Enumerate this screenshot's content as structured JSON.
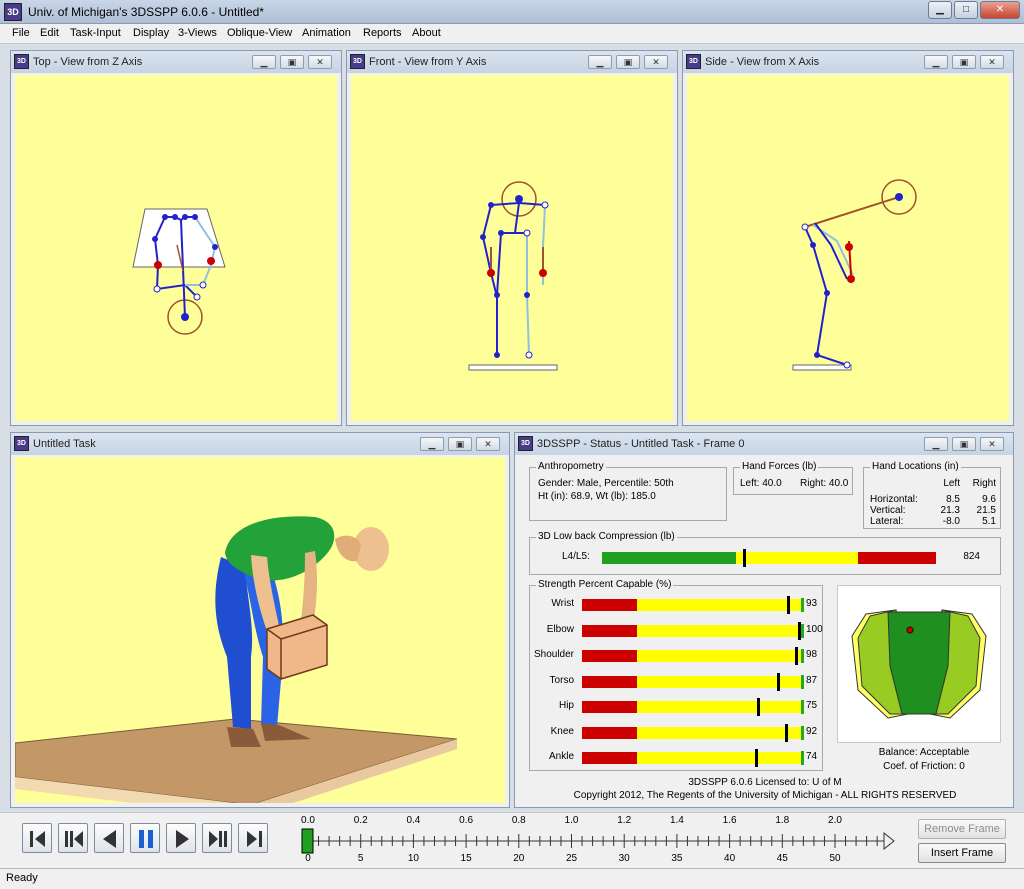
{
  "window": {
    "title": "Univ. of Michigan's 3DSSPP 6.0.6 - Untitled*",
    "icon": "3DSSPP-app-icon",
    "icon_text": "3D",
    "controls": [
      "minimize",
      "maximize",
      "close"
    ]
  },
  "menu": [
    "File",
    "Edit",
    "Task-Input",
    "Display",
    "3-Views",
    "Oblique-View",
    "Animation",
    "Reports",
    "About"
  ],
  "views": {
    "top_title": "Top - View from Z Axis",
    "front_title": "Front - View from Y Axis",
    "side_title": "Side - View from X Axis",
    "task_title": "Untitled Task",
    "background_color": "#ffff99"
  },
  "status": {
    "title": "3DSSPP - Status - Untitled Task - Frame 0",
    "anthropometry": {
      "label": "Anthropometry",
      "line1": "Gender: Male, Percentile: 50th",
      "line2": "Ht (in): 68.9, Wt (lb): 185.0"
    },
    "hand_forces": {
      "label": "Hand Forces (lb)",
      "left": "Left:  40.0",
      "right": "Right:  40.0"
    },
    "hand_locations": {
      "label": "Hand Locations (in)",
      "col_left": "Left",
      "col_right": "Right",
      "rows": [
        {
          "label": "Horizontal:",
          "left": "8.5",
          "right": "9.6"
        },
        {
          "label": "Vertical:",
          "left": "21.3",
          "right": "21.5"
        },
        {
          "label": "Lateral:",
          "left": "-8.0",
          "right": "5.1"
        }
      ]
    },
    "low_back": {
      "label": "3D Low back Compression (lb)",
      "row_label": "L4/L5:",
      "value": "824",
      "colors": {
        "green": "#1fa01f",
        "yellow": "#ffff00",
        "red": "#cc0000"
      }
    },
    "strength": {
      "label": "Strength Percent Capable (%)",
      "rows": [
        {
          "label": "Wrist",
          "value": "93"
        },
        {
          "label": "Elbow",
          "value": "100"
        },
        {
          "label": "Shoulder",
          "value": "98"
        },
        {
          "label": "Torso",
          "value": "87"
        },
        {
          "label": "Hip",
          "value": "75"
        },
        {
          "label": "Knee",
          "value": "92"
        },
        {
          "label": "Ankle",
          "value": "74"
        }
      ]
    },
    "balance": "Balance: Acceptable",
    "friction": "Coef. of Friction:  0",
    "license": "3DSSPP 6.0.6 Licensed to: U of M",
    "copyright": "Copyright 2012, The Regents of the University of Michigan - ALL RIGHTS RESERVED"
  },
  "timeline": {
    "top_labels": [
      "0.0",
      "0.2",
      "0.4",
      "0.6",
      "0.8",
      "1.0",
      "1.2",
      "1.4",
      "1.6",
      "1.8",
      "2.0"
    ],
    "bottom_labels": [
      "0",
      "5",
      "10",
      "15",
      "20",
      "25",
      "30",
      "35",
      "40",
      "45",
      "50"
    ],
    "current_frame": 0
  },
  "playback": [
    "first-frame-icon",
    "step-back-icon",
    "play-reverse-icon",
    "pause-icon",
    "play-icon",
    "step-forward-icon",
    "last-frame-icon"
  ],
  "buttons": {
    "remove_frame": "Remove Frame",
    "insert_frame": "Insert Frame"
  },
  "statusbar": "Ready"
}
